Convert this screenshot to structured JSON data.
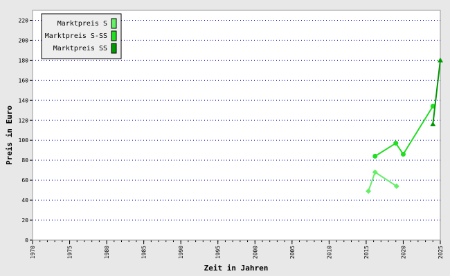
{
  "chart_data": {
    "type": "line",
    "xlabel": "Zeit in Jahren",
    "ylabel": "Preis in Euro",
    "xlim": [
      1970,
      2025
    ],
    "ylim": [
      0,
      230
    ],
    "x_ticks": [
      1970,
      1975,
      1980,
      1985,
      1990,
      1995,
      2000,
      2005,
      2010,
      2015,
      2020,
      2025
    ],
    "y_ticks": [
      0,
      20,
      40,
      60,
      80,
      100,
      120,
      140,
      160,
      180,
      200,
      220
    ],
    "grid": "horizontal dotted",
    "legend_position": "top-left",
    "series": [
      {
        "name": "Marktpreis S",
        "color": "#66ee66",
        "marker": "diamond",
        "points": [
          [
            2015.3,
            49
          ],
          [
            2016.2,
            68
          ],
          [
            2019.1,
            54
          ]
        ]
      },
      {
        "name": "Marktpreis S-SS",
        "color": "#22dd22",
        "marker": "circle",
        "points": [
          [
            2016.2,
            84
          ],
          [
            2019.0,
            97
          ],
          [
            2020.0,
            86
          ],
          [
            2024.0,
            134
          ]
        ]
      },
      {
        "name": "Marktpreis SS",
        "color": "#009900",
        "marker": "triangle",
        "points": [
          [
            2024.0,
            116
          ],
          [
            2025.0,
            180
          ]
        ]
      }
    ]
  }
}
